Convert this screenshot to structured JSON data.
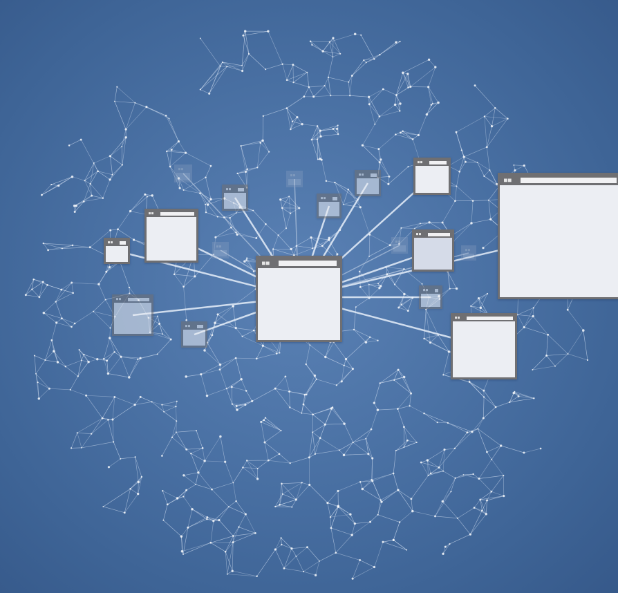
{
  "palette": {
    "mesh_line": "#d8e4f5",
    "spoke": "#e6eef9",
    "window_frame": "#6f6f72",
    "window_body": "#eceef3"
  },
  "windows": [
    {
      "name": "hub-window",
      "style": "normal"
    },
    {
      "name": "large-window",
      "style": "normal"
    },
    {
      "name": "window-lower-right",
      "style": "normal"
    },
    {
      "name": "window-upper-left",
      "style": "normal"
    },
    {
      "name": "window-top-right",
      "style": "normal"
    },
    {
      "name": "window-right-tinted",
      "style": "tinted"
    },
    {
      "name": "window-small-left",
      "style": "normal"
    },
    {
      "name": "window-left-textured",
      "style": "faded"
    },
    {
      "name": "window-small-lower-left",
      "style": "faded"
    },
    {
      "name": "window-small-top",
      "style": "faded"
    },
    {
      "name": "window-small-top-2",
      "style": "faded"
    },
    {
      "name": "window-small-top-3",
      "style": "faded"
    },
    {
      "name": "window-small-right",
      "style": "faded"
    },
    {
      "name": "window-ghost-1",
      "style": "ghost"
    },
    {
      "name": "window-ghost-2",
      "style": "ghost"
    },
    {
      "name": "window-ghost-3",
      "style": "ghost"
    },
    {
      "name": "window-ghost-4",
      "style": "ghost"
    },
    {
      "name": "window-ghost-5",
      "style": "ghost"
    }
  ]
}
